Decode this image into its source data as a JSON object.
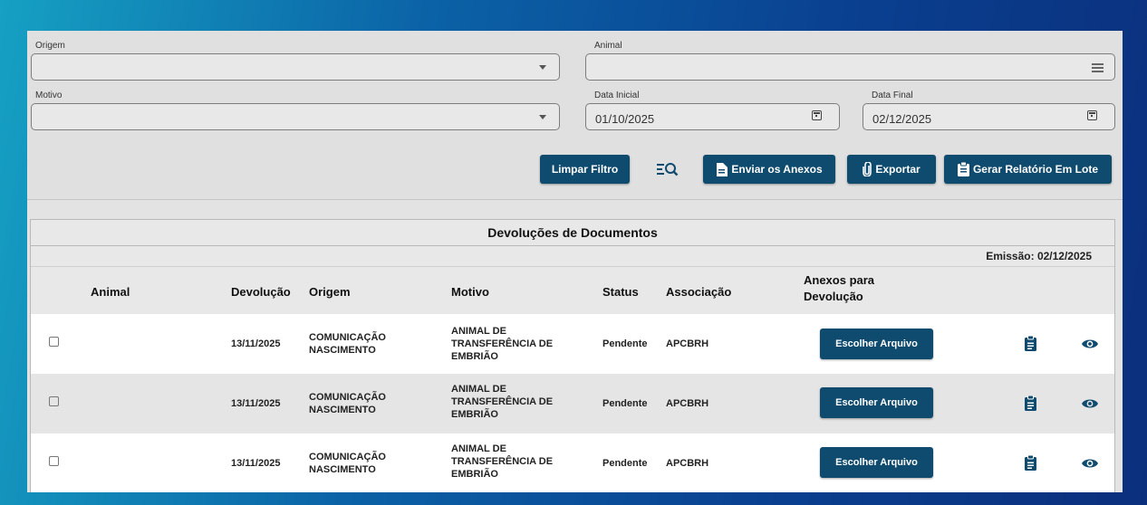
{
  "filters": {
    "origem": {
      "label": "Origem",
      "value": ""
    },
    "animal": {
      "label": "Animal",
      "value": ""
    },
    "motivo": {
      "label": "Motivo",
      "value": ""
    },
    "data_inicial": {
      "label": "Data Inicial",
      "value": "01/10/2025"
    },
    "data_final": {
      "label": "Data Final",
      "value": "02/12/2025"
    }
  },
  "toolbar": {
    "limpar": "Limpar Filtro",
    "enviar": "Enviar os Anexos",
    "exportar": "Exportar",
    "gerar": "Gerar Relatório Em Lote"
  },
  "table": {
    "title": "Devoluções de Documentos",
    "emissao": "Emissão: 02/12/2025",
    "headers": {
      "animal": "Animal",
      "devolucao": "Devolução",
      "origem": "Origem",
      "motivo": "Motivo",
      "status": "Status",
      "associacao": "Associação",
      "anexos": "Anexos para Devolução"
    },
    "rows": [
      {
        "animal": "",
        "devolucao": "13/11/2025",
        "origem": "COMUNICAÇÃO NASCIMENTO",
        "motivo": "ANIMAL DE TRANSFERÊNCIA DE EMBRIÃO",
        "status": "Pendente",
        "associacao": "APCBRH",
        "anexo_btn": "Escolher Arquivo"
      },
      {
        "animal": "",
        "devolucao": "13/11/2025",
        "origem": "COMUNICAÇÃO NASCIMENTO",
        "motivo": "ANIMAL DE TRANSFERÊNCIA DE EMBRIÃO",
        "status": "Pendente",
        "associacao": "APCBRH",
        "anexo_btn": "Escolher Arquivo"
      },
      {
        "animal": "",
        "devolucao": "13/11/2025",
        "origem": "COMUNICAÇÃO NASCIMENTO",
        "motivo": "ANIMAL DE TRANSFERÊNCIA DE EMBRIÃO",
        "status": "Pendente",
        "associacao": "APCBRH",
        "anexo_btn": "Escolher Arquivo"
      }
    ]
  },
  "icons": {
    "filter_search": "filter-search-icon",
    "document": "document-icon",
    "paperclip": "paperclip-icon",
    "clipboard": "clipboard-icon",
    "eye": "eye-icon",
    "calendar": "calendar-icon"
  },
  "colors": {
    "primary_button": "#0f4b6e",
    "background_gradient_start": "#16a0c3",
    "background_gradient_end": "#0b2f7c"
  }
}
